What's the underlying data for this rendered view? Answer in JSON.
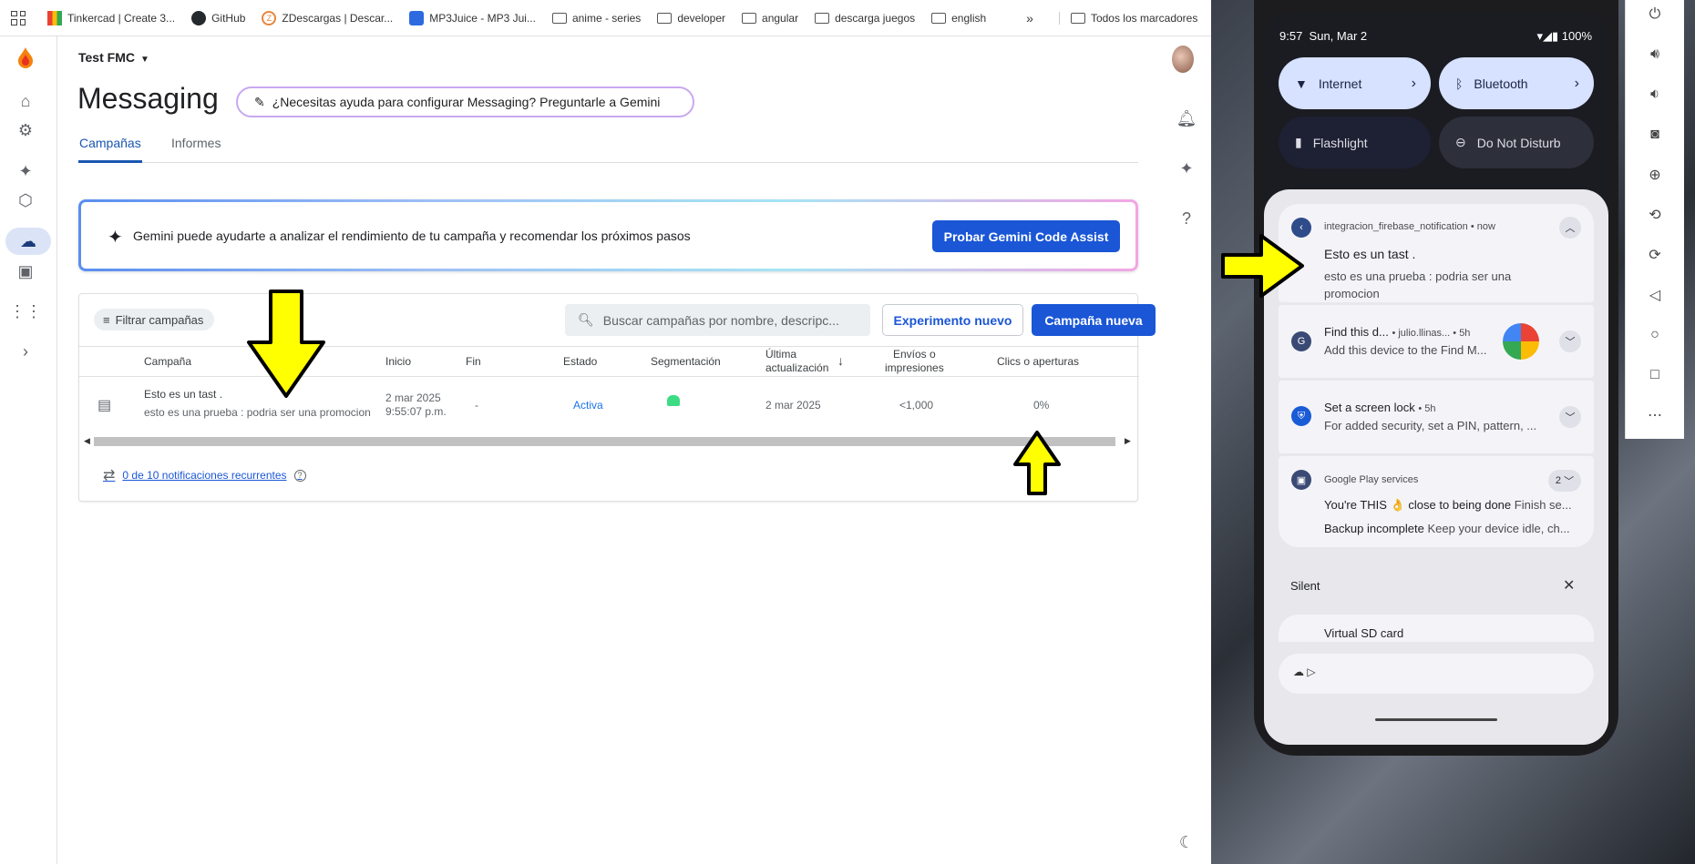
{
  "bookmarks": {
    "items": [
      {
        "label": "Tinkercad | Create 3...",
        "icon": "tinkercad-icon"
      },
      {
        "label": "GitHub",
        "icon": "github-icon"
      },
      {
        "label": "ZDescargas | Descar...",
        "icon": "zdescargas-icon"
      },
      {
        "label": "MP3Juice - MP3 Jui...",
        "icon": "mp3juice-icon"
      },
      {
        "label": "anime - series",
        "icon": "folder-icon"
      },
      {
        "label": "developer",
        "icon": "folder-icon"
      },
      {
        "label": "angular",
        "icon": "folder-icon"
      },
      {
        "label": "descarga juegos",
        "icon": "folder-icon"
      },
      {
        "label": "english",
        "icon": "folder-icon"
      }
    ],
    "all_label": "Todos los marcadores"
  },
  "header": {
    "project": "Test FMC",
    "title": "Messaging",
    "gemini_help": "¿Necesitas ayuda para configurar Messaging? Preguntarle a Gemini"
  },
  "tabs": [
    {
      "label": "Campañas",
      "active": true
    },
    {
      "label": "Informes",
      "active": false
    }
  ],
  "banner": {
    "text": "Gemini puede ayudarte a analizar el rendimiento de tu campaña y recomendar los próximos pasos",
    "button": "Probar Gemini Code Assist"
  },
  "toolbar": {
    "filter_label": "Filtrar campañas",
    "search_placeholder": "Buscar campañas por nombre, descripc...",
    "new_experiment": "Experimento nuevo",
    "new_campaign": "Campaña nueva"
  },
  "table": {
    "columns": {
      "campaign": "Campaña",
      "start": "Inicio",
      "end": "Fin",
      "status": "Estado",
      "segment": "Segmentación",
      "last_update_1": "Última",
      "last_update_2": "actualización",
      "sends_1": "Envíos o",
      "sends_2": "impresiones",
      "clicks": "Clics o aperturas"
    },
    "rows": [
      {
        "title": "Esto es un tast .",
        "body": "esto es una prueba : podria ser una promocion",
        "start_date": "2 mar 2025",
        "start_time": "9:55:07 p.m.",
        "end": "-",
        "status": "Activa",
        "last_update": "2 mar 2025",
        "sends": "<1,000",
        "clicks": "0%"
      }
    ]
  },
  "recurring": "0 de 10 notificaciones recurrentes",
  "phone": {
    "time": "9:57",
    "date": "Sun, Mar 2",
    "battery": "100%",
    "tiles": [
      {
        "label": "Internet",
        "on": true
      },
      {
        "label": "Bluetooth",
        "on": true
      },
      {
        "label": "Flashlight",
        "on": false
      },
      {
        "label": "Do Not Disturb",
        "on": false
      }
    ],
    "notifications": [
      {
        "app": "integracion_firebase_notification",
        "when": "now",
        "title": "Esto es un tast .",
        "body": "esto es una prueba : podria ser una",
        "body2": "promocion"
      },
      {
        "title": "Find this d...",
        "meta": "julio.llinas...",
        "when": "5h",
        "body": "Add this device to the Find M..."
      },
      {
        "title": "Set a screen lock",
        "when": "5h",
        "body": "For added security, set a PIN, pattern, ..."
      },
      {
        "app": "Google Play services",
        "count": "2",
        "line1": "You're THIS 👌 close to being done",
        "line1b": "Finish se...",
        "line2": "Backup incomplete",
        "line2b": "Keep your device idle, ch..."
      }
    ],
    "silent_label": "Silent",
    "silent_item": "Virtual SD card"
  }
}
